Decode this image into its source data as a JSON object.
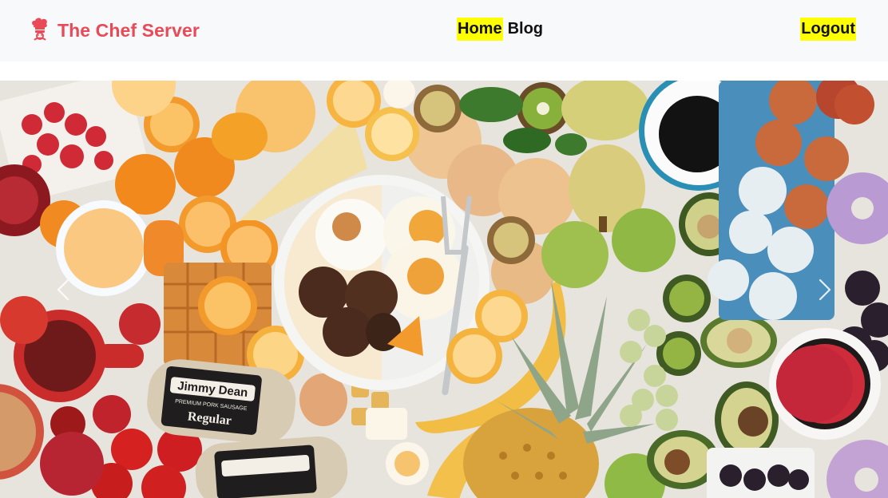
{
  "navbar": {
    "brand": {
      "name": "The Chef Server",
      "icon": "chef-hat-icon",
      "color": "#e84a57"
    },
    "links": [
      {
        "label": "Home",
        "active": true
      },
      {
        "label": "Blog",
        "active": false
      }
    ],
    "logout_label": "Logout",
    "highlight_color": "#ffff00",
    "background": "#f8f9fa"
  },
  "carousel": {
    "controls": {
      "prev_icon": "chevron-left-icon",
      "next_icon": "chevron-right-icon"
    },
    "slide_image": "breakfast-spread-photo",
    "package_text": {
      "brand": "Jimmy Dean",
      "tagline": "PREMIUM PORK SAUSAGE",
      "variant": "Regular"
    }
  }
}
